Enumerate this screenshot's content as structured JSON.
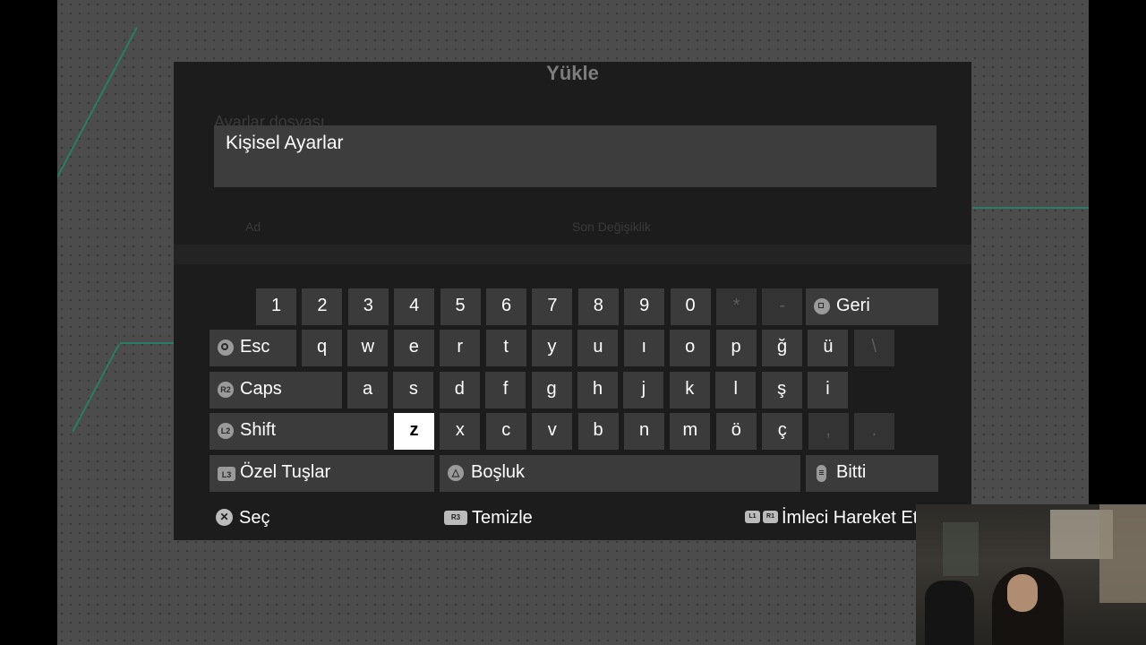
{
  "background": {
    "ghost_title": "Yükle",
    "ghost_heading": "Ayarlar dosyası",
    "ghost_col1": "Ad",
    "ghost_col2": "Son Değişiklik"
  },
  "input": {
    "value": "Kişisel Ayarlar"
  },
  "keyboard": {
    "rows": [
      [
        "1",
        "2",
        "3",
        "4",
        "5",
        "6",
        "7",
        "8",
        "9",
        "0",
        "*",
        "-"
      ],
      [
        "q",
        "w",
        "e",
        "r",
        "t",
        "y",
        "u",
        "ı",
        "o",
        "p",
        "ğ",
        "ü",
        "\\"
      ],
      [
        "a",
        "s",
        "d",
        "f",
        "g",
        "h",
        "j",
        "k",
        "l",
        "ş",
        "i"
      ],
      [
        "z",
        "x",
        "c",
        "v",
        "b",
        "n",
        "m",
        "ö",
        "ç",
        ",",
        "."
      ]
    ],
    "special": {
      "back": "Geri",
      "esc": "Esc",
      "caps": "Caps",
      "shift": "Shift",
      "special_keys": "Özel Tuşlar",
      "space": "Boşluk",
      "done": "Bitti"
    },
    "button_hints": {
      "caps": "R2",
      "shift": "L2",
      "special_keys": "L3"
    },
    "focused_key": "z"
  },
  "footer": {
    "select": "Seç",
    "clear": "Temizle",
    "clear_button": "R3",
    "move_cursor": "İmleci Hareket Et",
    "move_l": "L1",
    "move_r": "R1"
  },
  "colors": {
    "dialog_bg": "#1b1c1b",
    "key_bg": "#3b3b3b",
    "focus_bg": "#ffffff",
    "accent_line": "#1f8d6a"
  }
}
